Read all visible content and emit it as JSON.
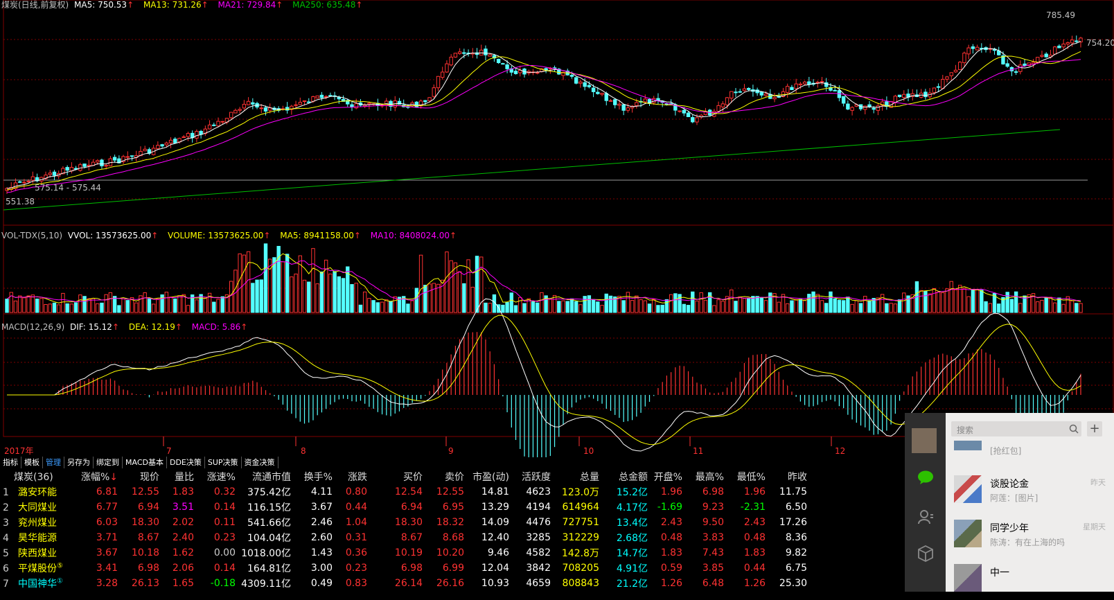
{
  "colors": {
    "up": "#ff3232",
    "down": "#54ffff",
    "ma5": "#ffffff",
    "ma13": "#ffff00",
    "ma21": "#ff00ff",
    "ma250": "#00c000",
    "grid": "#800000",
    "text": "#c0c0c0"
  },
  "main_header": {
    "name": "煤炭(日线,前复权)",
    "ma5": "MA5: 750.53",
    "ma13": "MA13: 731.26",
    "ma21": "MA21: 729.84",
    "ma250": "MA250: 635.48",
    "arrow": "↑"
  },
  "price_labels": {
    "high": "785.49",
    "right": "754.20",
    "low1": "575.14 - 575.44",
    "low2": "551.38"
  },
  "vol_header": {
    "name": "VOL-TDX(5,10)",
    "vvol": "VVOL: 13573625.00",
    "volume": "VOLUME: 13573625.00",
    "ma5": "MA5: 8941158.00",
    "ma10": "MA10: 8408024.00",
    "arrow": "↑"
  },
  "macd_header": {
    "name": "MACD(12,26,9)",
    "dif": "DIF: 15.12",
    "dea": "DEA: 12.19",
    "macd": "MACD: 5.86",
    "arrow": "↑"
  },
  "date_axis": {
    "labels": [
      "2017年",
      "7",
      "8",
      "9",
      "10",
      "11",
      "12"
    ]
  },
  "tabs": [
    "指标",
    "模板",
    "管理",
    "另存为",
    "绑定到",
    "MACD基本",
    "DDE决策",
    "SUP决策",
    "资金决策"
  ],
  "active_tab": "管理",
  "table": {
    "headers": [
      "煤炭(36)",
      "涨幅%",
      "现价",
      "量比",
      "涨速%",
      "流通市值",
      "换手%",
      "涨跌",
      "买价",
      "卖价",
      "市盈(动)",
      "活跃度",
      "总量",
      "总金额",
      "开盘%",
      "最高%",
      "最低%",
      "昨收"
    ],
    "sort_arrow": "↓",
    "rows": [
      {
        "idx": "1",
        "name": "潞安环能",
        "mark": "",
        "chg": "6.81",
        "price": "12.55",
        "lb": "1.83",
        "speed": "0.32",
        "mcap": "375.42亿",
        "turn": "4.11",
        "diff": "0.80",
        "buy": "12.54",
        "sell": "12.55",
        "pe": "14.81",
        "active": "4623",
        "vol": "123.0万",
        "amt": "15.2亿",
        "open": "1.96",
        "high": "6.98",
        "low": "1.96",
        "prev": "11.75"
      },
      {
        "idx": "2",
        "name": "大同煤业",
        "mark": "",
        "chg": "6.77",
        "price": "6.94",
        "lb": "3.51",
        "speed": "0.14",
        "mcap": "116.15亿",
        "turn": "3.67",
        "diff": "0.44",
        "buy": "6.94",
        "sell": "6.95",
        "pe": "13.29",
        "active": "4194",
        "vol": "614964",
        "amt": "4.17亿",
        "open": "-1.69",
        "high": "9.23",
        "low": "-2.31",
        "prev": "6.50"
      },
      {
        "idx": "3",
        "name": "兖州煤业",
        "mark": "",
        "chg": "6.03",
        "price": "18.30",
        "lb": "2.02",
        "speed": "0.11",
        "mcap": "541.66亿",
        "turn": "2.46",
        "diff": "1.04",
        "buy": "18.30",
        "sell": "18.32",
        "pe": "14.09",
        "active": "4476",
        "vol": "727751",
        "amt": "13.4亿",
        "open": "2.43",
        "high": "9.50",
        "low": "2.43",
        "prev": "17.26"
      },
      {
        "idx": "4",
        "name": "昊华能源",
        "mark": "",
        "chg": "3.71",
        "price": "8.67",
        "lb": "2.40",
        "speed": "0.23",
        "mcap": "104.04亿",
        "turn": "2.60",
        "diff": "0.31",
        "buy": "8.67",
        "sell": "8.68",
        "pe": "12.40",
        "active": "3285",
        "vol": "312229",
        "amt": "2.68亿",
        "open": "0.48",
        "high": "3.83",
        "low": "0.48",
        "prev": "8.36"
      },
      {
        "idx": "5",
        "name": "陕西煤业",
        "mark": "",
        "chg": "3.67",
        "price": "10.18",
        "lb": "1.62",
        "speed": "0.00",
        "mcap": "1018.00亿",
        "turn": "1.43",
        "diff": "0.36",
        "buy": "10.19",
        "sell": "10.20",
        "pe": "9.46",
        "active": "4582",
        "vol": "142.8万",
        "amt": "14.7亿",
        "open": "1.83",
        "high": "7.43",
        "low": "1.83",
        "prev": "9.82"
      },
      {
        "idx": "6",
        "name": "平煤股份",
        "mark": "⑤",
        "chg": "3.41",
        "price": "6.98",
        "lb": "2.06",
        "speed": "0.14",
        "mcap": "164.81亿",
        "turn": "3.00",
        "diff": "0.23",
        "buy": "6.98",
        "sell": "6.99",
        "pe": "12.04",
        "active": "3842",
        "vol": "708205",
        "amt": "4.91亿",
        "open": "0.59",
        "high": "3.85",
        "low": "0.44",
        "prev": "6.75"
      },
      {
        "idx": "7",
        "name": "中国神华",
        "mark": "①",
        "chg": "3.28",
        "price": "26.13",
        "lb": "1.65",
        "speed": "-0.18",
        "mcap": "4309.11亿",
        "turn": "0.49",
        "diff": "0.83",
        "buy": "26.14",
        "sell": "26.16",
        "pe": "10.93",
        "active": "4659",
        "vol": "808843",
        "amt": "21.2亿",
        "open": "1.26",
        "high": "6.48",
        "low": "1.26",
        "prev": "25.30"
      }
    ]
  },
  "wechat": {
    "search_placeholder": "搜索",
    "add_glyph": "+",
    "items": [
      {
        "name": "",
        "msg": "[抢红包]",
        "time": ""
      },
      {
        "name": "谈股论金",
        "msg": "阿莲：[图片]",
        "time": "昨天"
      },
      {
        "name": "同学少年",
        "msg": "陈涛：有在上海的吗",
        "time": "星期天"
      },
      {
        "name": "中一",
        "msg": "",
        "time": ""
      }
    ]
  }
}
